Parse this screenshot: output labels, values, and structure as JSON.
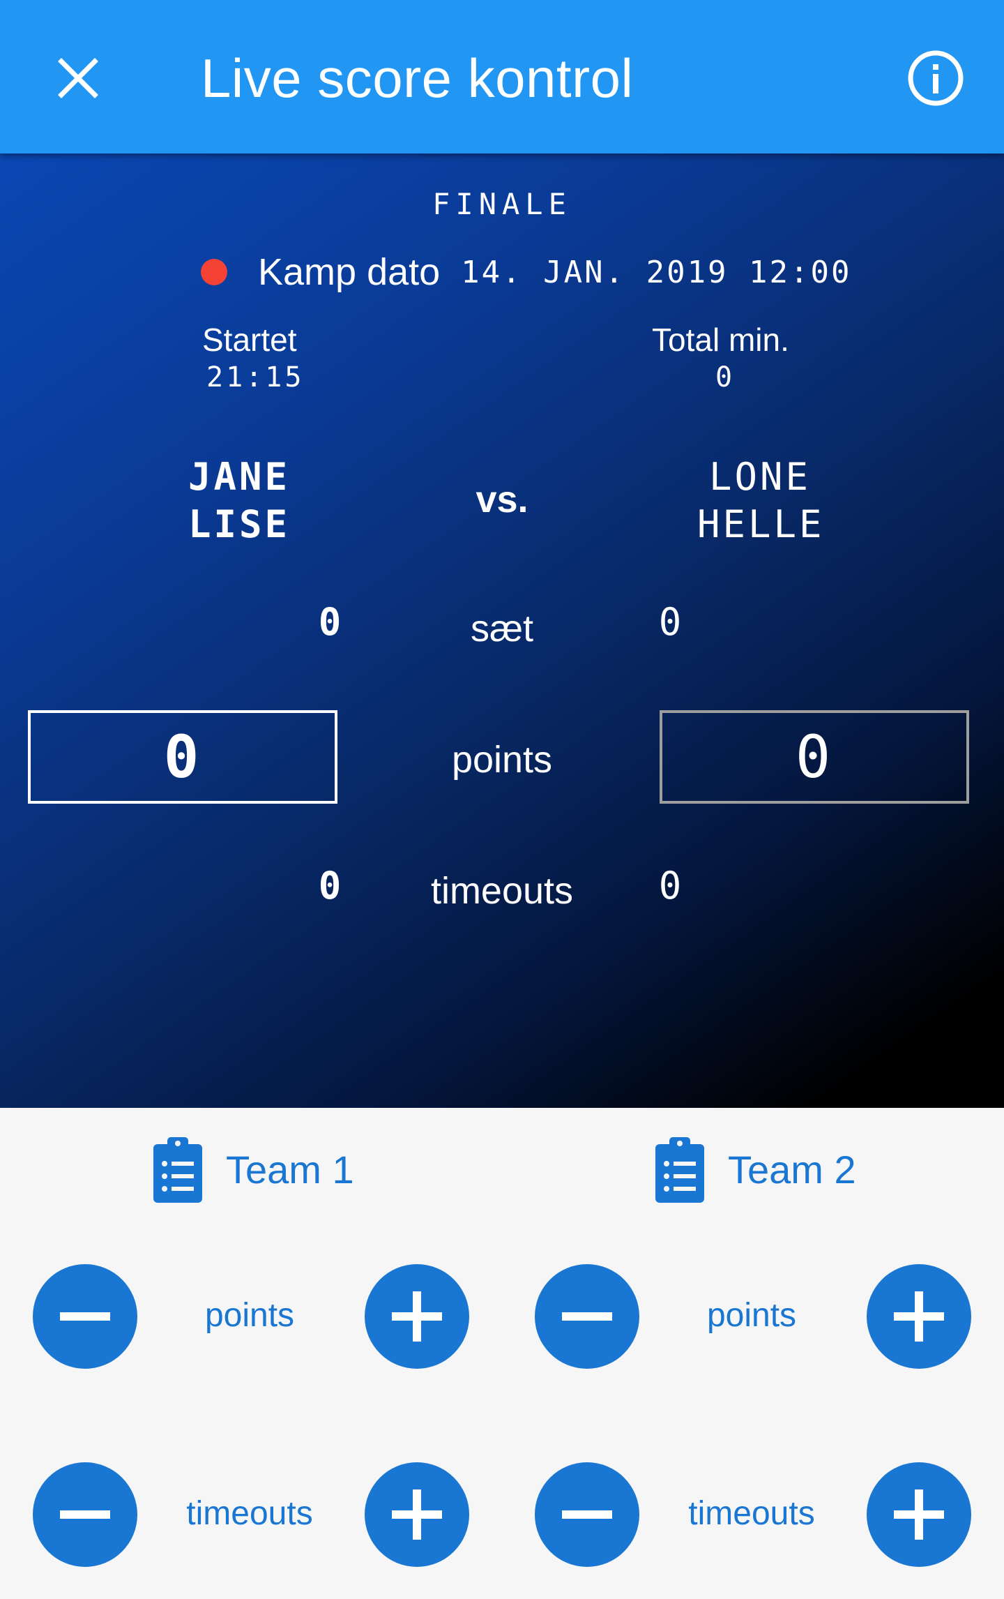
{
  "header": {
    "title": "Live score kontrol",
    "close_icon": "close-icon",
    "info_icon": "info-icon",
    "background": "#2196f3"
  },
  "match": {
    "round": "FINALE",
    "status_color": "#f44336",
    "date_label": "Kamp dato",
    "date_value": "14. JAN. 2019 12:00",
    "started_label": "Startet",
    "started_value": "21:15",
    "total_label": "Total min.",
    "total_value": "0",
    "vs_label": "vs."
  },
  "team1": {
    "player1": "JANE",
    "player2": "LISE",
    "sets": "0",
    "points": "0",
    "timeouts": "0"
  },
  "team2": {
    "player1": "LONE",
    "player2": "HELLE",
    "sets": "0",
    "points": "0",
    "timeouts": "0"
  },
  "labels": {
    "sets": "sæt",
    "points": "points",
    "timeouts": "timeouts"
  },
  "controls": {
    "team1_label": "Team 1",
    "team2_label": "Team 2",
    "points_label": "points",
    "timeouts_label": "timeouts",
    "accent": "#1976d2",
    "team_icon": "clipboard-list-icon",
    "minus_icon": "minus-icon",
    "plus_icon": "plus-icon"
  }
}
